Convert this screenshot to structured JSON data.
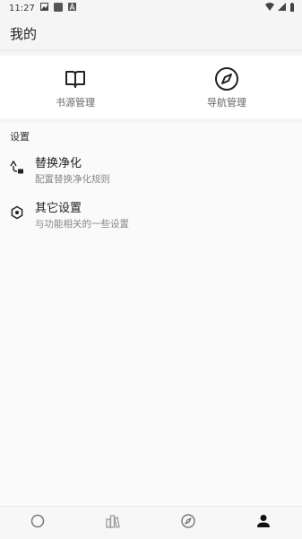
{
  "status_bar": {
    "time": "11:27",
    "icons": [
      "image-icon",
      "square-app-icon",
      "a-icon",
      "wifi-icon",
      "signal-icon",
      "battery-icon"
    ]
  },
  "app_bar": {
    "title": "我的"
  },
  "quick_actions": [
    {
      "label": "书源管理",
      "icon": "book-icon"
    },
    {
      "label": "导航管理",
      "icon": "compass-icon"
    }
  ],
  "settings": {
    "section_title": "设置",
    "items": [
      {
        "title": "替换净化",
        "subtitle": "配置替换净化规则",
        "icon": "replace-rule-icon"
      },
      {
        "title": "其它设置",
        "subtitle": "与功能相关的一些设置",
        "icon": "settings-gear-icon"
      }
    ]
  },
  "bottom_nav": [
    {
      "icon": "circle-icon",
      "active": false
    },
    {
      "icon": "bookshelf-icon",
      "active": false
    },
    {
      "icon": "compass-icon",
      "active": false
    },
    {
      "icon": "person-icon",
      "active": true
    }
  ],
  "colors": {
    "active": "#111111",
    "inactive": "#777777",
    "divider": "#e4e4e4"
  }
}
